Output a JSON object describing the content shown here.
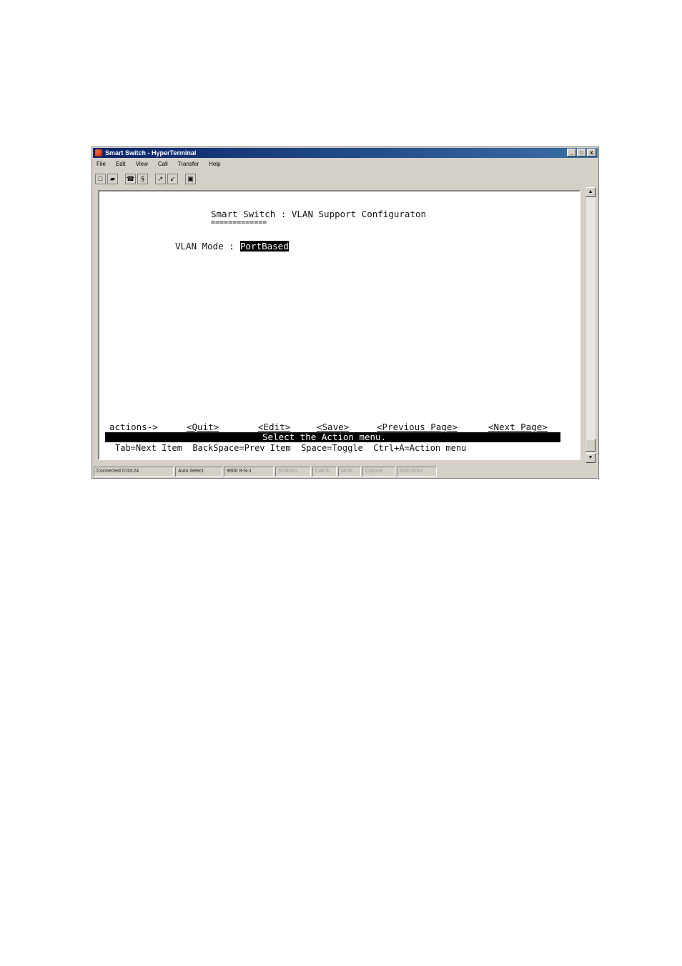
{
  "window": {
    "title": "Smart Switch - HyperTerminal",
    "buttons": [
      "_",
      "□",
      "x"
    ]
  },
  "menu": [
    "File",
    "Edit",
    "View",
    "Call",
    "Transfer",
    "Help"
  ],
  "terminal": {
    "header": "Smart Switch : VLAN Support Configuraton",
    "header_underline": "=============",
    "vlan_mode_label": "VLAN Mode :",
    "vlan_mode_value": "PortBased",
    "actions": {
      "label": "actions->",
      "quit": "<Quit>",
      "edit": "<Edit>",
      "save": "<Save>",
      "previous": "<Previous Page>",
      "next": "<Next Page>"
    },
    "status_message": "Select the Action menu.",
    "help_line": "Tab=Next Item  BackSpace=Prev Item  Space=Toggle  Ctrl+A=Action menu"
  },
  "statusbar": {
    "connected": "Connected 0:03:24",
    "detect": "Auto detect",
    "settings": "9600 8-N-1",
    "scroll": "SCROLL",
    "caps": "CAPS",
    "num": "NUM",
    "capture": "Capture",
    "print_echo": "Print echo"
  }
}
